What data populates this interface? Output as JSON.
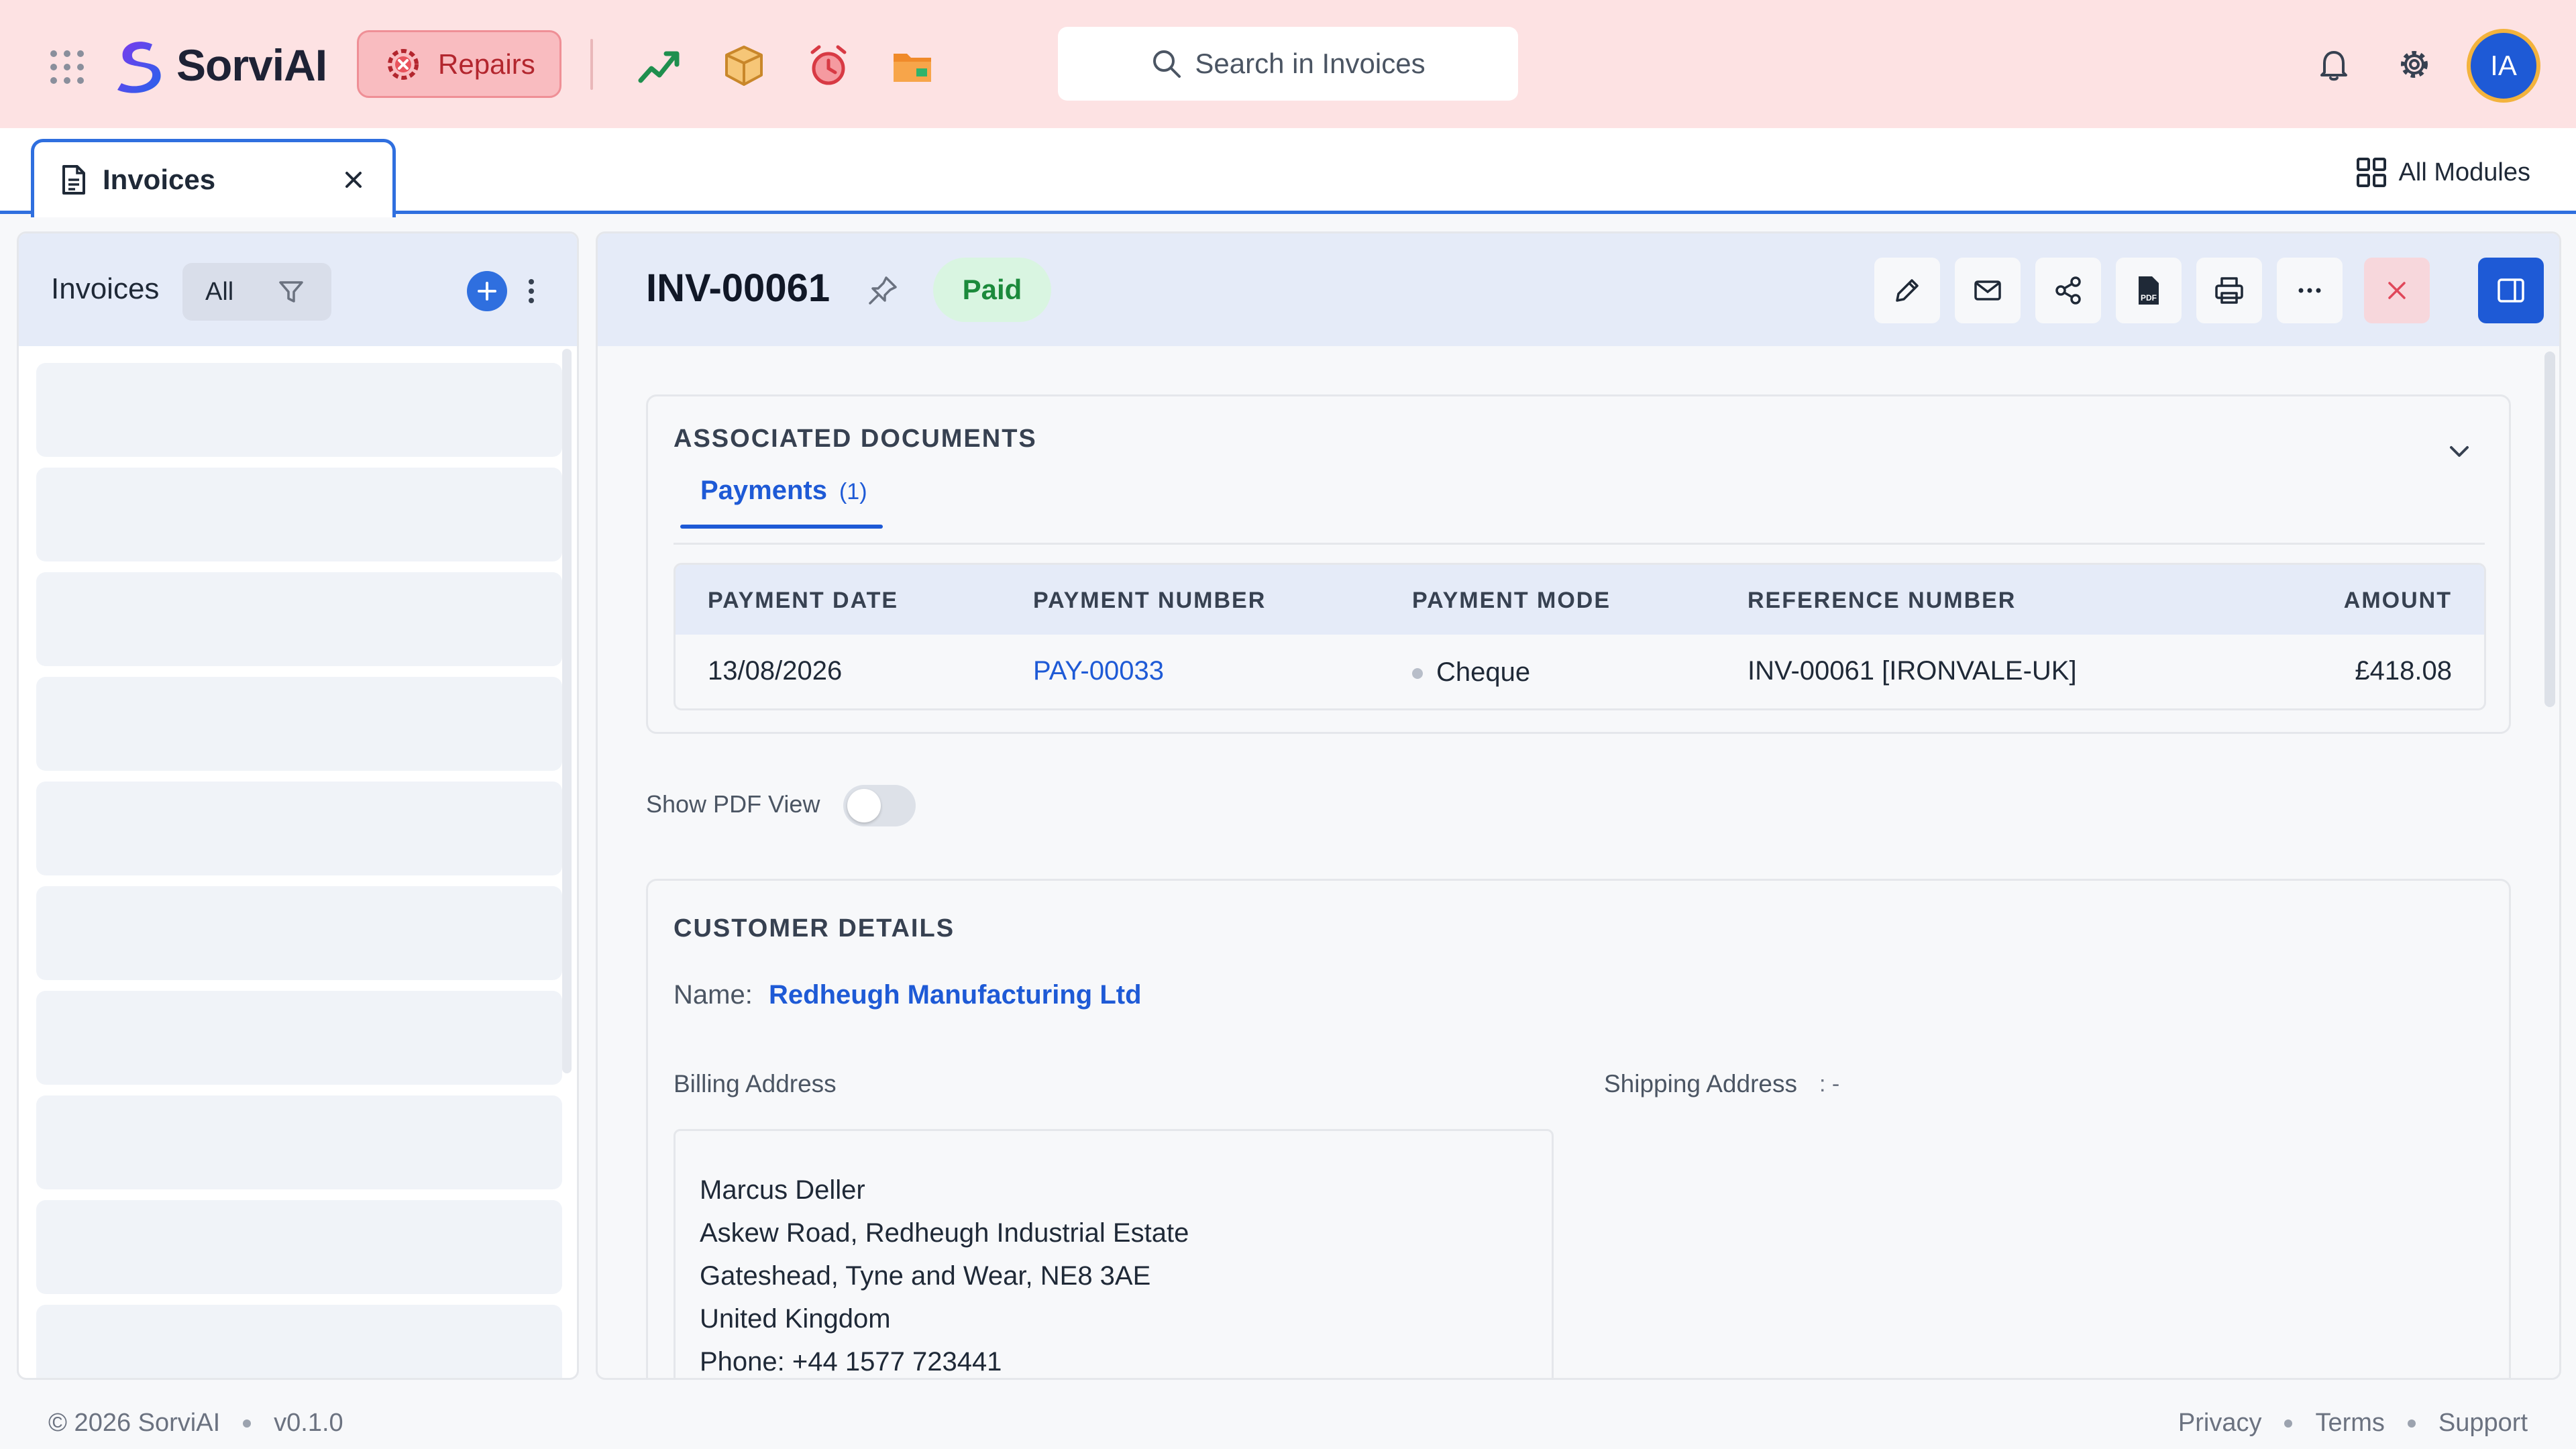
{
  "app": {
    "name": "SorviAI",
    "module_button": "Repairs"
  },
  "search": {
    "placeholder": "Search in Invoices"
  },
  "user": {
    "initials": "IA"
  },
  "colors": {
    "accent": "#1e5ad6",
    "topbar": "#fde2e3",
    "status_paid_bg": "#d9f5e1",
    "status_paid_text": "#1b8a3b"
  },
  "icons": {
    "topbar": [
      "apps-grid-icon",
      "repairs-gear-icon",
      "trend-chart-icon",
      "box-icon",
      "alarm-clock-icon",
      "folder-icon",
      "bell-icon",
      "settings-gear-icon"
    ],
    "actions": [
      "edit-pencil-icon",
      "mail-icon",
      "share-icon",
      "pdf-icon",
      "print-icon",
      "more-horizontal-icon",
      "close-icon",
      "panel-toggle-icon"
    ]
  },
  "tabs": [
    {
      "label": "Invoices",
      "active": true
    }
  ],
  "all_modules_label": "All Modules",
  "list_panel": {
    "title": "Invoices",
    "filter_value": "All"
  },
  "invoice": {
    "number": "INV-00061",
    "status": "Paid"
  },
  "associated_documents": {
    "title": "ASSOCIATED DOCUMENTS",
    "subtab_label": "Payments",
    "subtab_count": "(1)",
    "columns": [
      "PAYMENT DATE",
      "PAYMENT NUMBER",
      "PAYMENT MODE",
      "REFERENCE NUMBER",
      "AMOUNT"
    ],
    "rows": [
      {
        "date": "13/08/2026",
        "number": "PAY-00033",
        "mode": "Cheque",
        "reference": "INV-00061 [IRONVALE-UK]",
        "amount": "£418.08"
      }
    ]
  },
  "pdf_view": {
    "label": "Show PDF View",
    "enabled": false
  },
  "customer_details": {
    "title": "CUSTOMER DETAILS",
    "name_label": "Name:",
    "name": "Redheugh Manufacturing Ltd",
    "billing_label": "Billing Address",
    "shipping_label": "Shipping Address",
    "shipping_value": ": -",
    "billing_lines": [
      "Marcus Deller",
      "Askew Road, Redheugh Industrial Estate",
      "Gateshead, Tyne and Wear, NE8 3AE",
      "United Kingdom",
      "Phone: +44 1577 723441"
    ]
  },
  "footer": {
    "copyright": "© 2026 SorviAI",
    "version": "v0.1.0",
    "links": [
      "Privacy",
      "Terms",
      "Support"
    ]
  }
}
